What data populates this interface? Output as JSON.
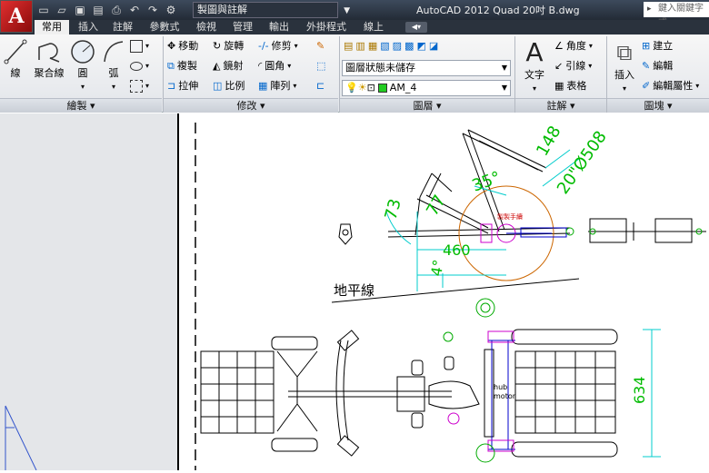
{
  "app": {
    "logo_letter": "A",
    "title": "AutoCAD 2012   Quad  20吋 B.dwg",
    "workspace": "製圖與註解",
    "search_placeholder": "鍵入關鍵字或"
  },
  "tabs": [
    {
      "label": "常用"
    },
    {
      "label": "插入"
    },
    {
      "label": "註解"
    },
    {
      "label": "參數式"
    },
    {
      "label": "檢視"
    },
    {
      "label": "管理"
    },
    {
      "label": "輸出"
    },
    {
      "label": "外掛程式"
    },
    {
      "label": "線上"
    }
  ],
  "ribbon": {
    "draw": {
      "footer": "繪製 ▾",
      "line": "線",
      "polyline": "聚合線",
      "circle": "圓",
      "arc": "弧"
    },
    "modify": {
      "footer": "修改 ▾",
      "move": "移動",
      "rotate": "旋轉",
      "trim": "修剪",
      "copy": "複製",
      "mirror": "鏡射",
      "fillet": "圓角",
      "stretch": "拉伸",
      "scale": "比例",
      "array": "陣列"
    },
    "layers": {
      "footer": "圖層 ▾",
      "layer_state": "圖層狀態未儲存",
      "current_layer": "AM_4",
      "layer_color": "#22cc22"
    },
    "annotation": {
      "footer": "註解 ▾",
      "text": "文字",
      "angle": "角度",
      "leader": "引線",
      "table": "表格"
    },
    "block": {
      "footer": "圖塊 ▾",
      "insert": "插入",
      "create": "建立",
      "edit": "編輯",
      "edit_attr": "編輯屬性"
    }
  },
  "drawing": {
    "dims": [
      "148",
      "20\"Ø508",
      "35°",
      "77",
      "73",
      "460",
      "4°",
      "634"
    ],
    "horizon_label": "地平線",
    "callout": "製製手續",
    "motor_label_1": "hub",
    "motor_label_2": "motor"
  }
}
